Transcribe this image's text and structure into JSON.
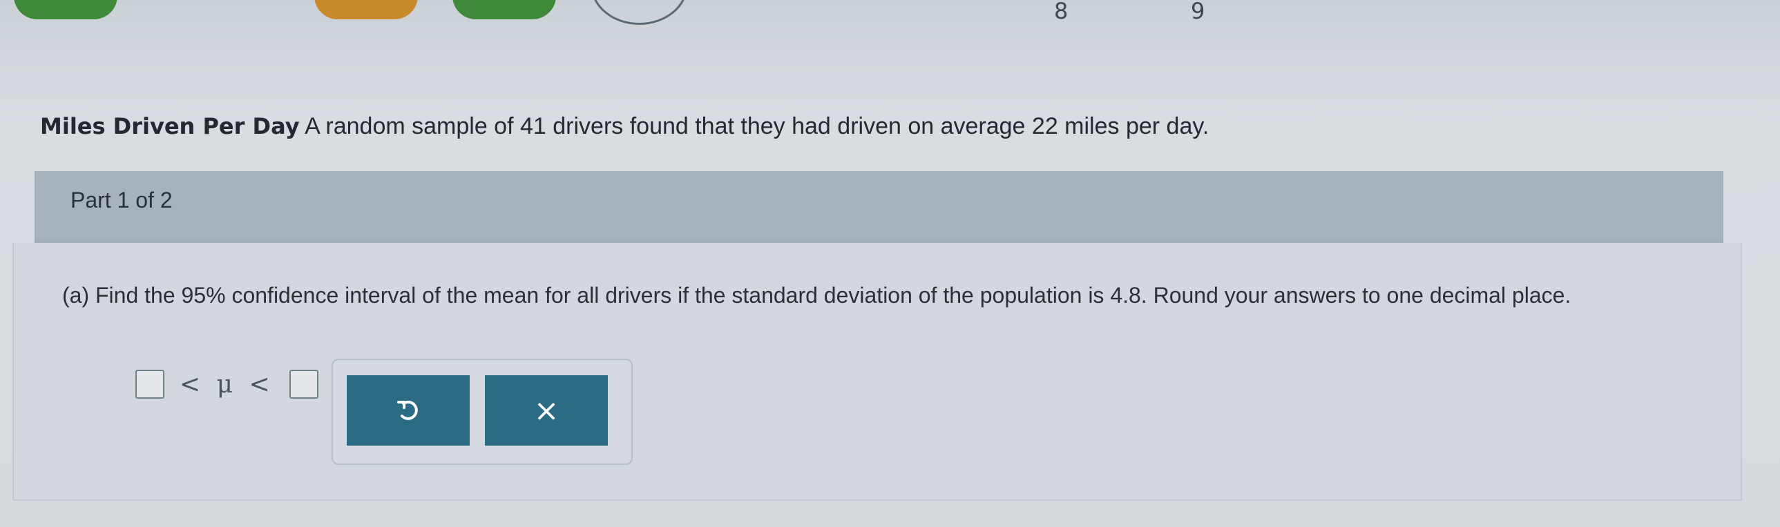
{
  "progress": {
    "steps": [
      {
        "num": "8"
      },
      {
        "num": "9"
      }
    ],
    "colors": {
      "done_green": "#3f8a3a",
      "done_orange": "#c98a2a"
    }
  },
  "question": {
    "title_bold": "Miles Driven Per Day",
    "title_text": "A random sample of 41 drivers found that they had driven on average 22 miles per day."
  },
  "part": {
    "label": "Part 1 of 2"
  },
  "instruction": "(a) Find the 95% confidence interval of the mean for all drivers if the standard deviation of the population is 4.8. Round your answers to one decimal place.",
  "answer": {
    "lower_value": "",
    "upper_value": "",
    "symbol": "< μ <"
  },
  "tools": {
    "undo_icon": "undo-icon",
    "clear_label": "×"
  }
}
